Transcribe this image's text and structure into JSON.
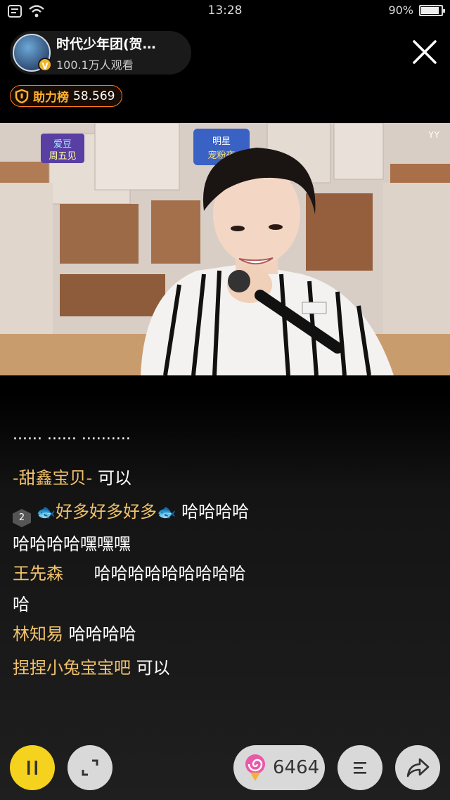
{
  "status_bar": {
    "time": "13:28",
    "battery_text": "90%",
    "battery_level": 0.9,
    "icons": [
      "notification-icon",
      "wifi-icon",
      "battery-icon"
    ]
  },
  "header": {
    "host_name": "时代少年团(贺…",
    "viewers": "100.1万人观看",
    "verified_badge": "V",
    "close_icon": "close-icon"
  },
  "rank": {
    "label": "助力榜",
    "score": "58.569",
    "icon": "shield-icon"
  },
  "video": {
    "watermark": "YY",
    "sign_left": "爱豆周五见",
    "sign_center": "明星宠粉夜"
  },
  "chat": {
    "faded_line": "...... ...... ..........",
    "messages": [
      {
        "user": "-甜鑫宝贝-",
        "text": "可以"
      },
      {
        "badge": "2",
        "user": "好多好多好多",
        "text": "哈哈哈哈",
        "text2": "哈哈哈哈嘿嘿嘿"
      },
      {
        "user": "王先森",
        "text": "哈哈哈哈哈哈哈哈哈",
        "text2": "哈"
      },
      {
        "user": "林知易",
        "text": "哈哈哈哈"
      },
      {
        "user": "捏捏小兔宝宝吧",
        "text": "可以"
      }
    ]
  },
  "bottom": {
    "gift_count": "6464",
    "icons": [
      "pause-icon",
      "fullscreen-icon",
      "lollipop-icon",
      "menu-icon",
      "share-icon"
    ]
  },
  "colors": {
    "accent_yellow": "#f4d21e",
    "username_gold": "#f1c26b",
    "rank_orange": "#ff7a1a"
  }
}
